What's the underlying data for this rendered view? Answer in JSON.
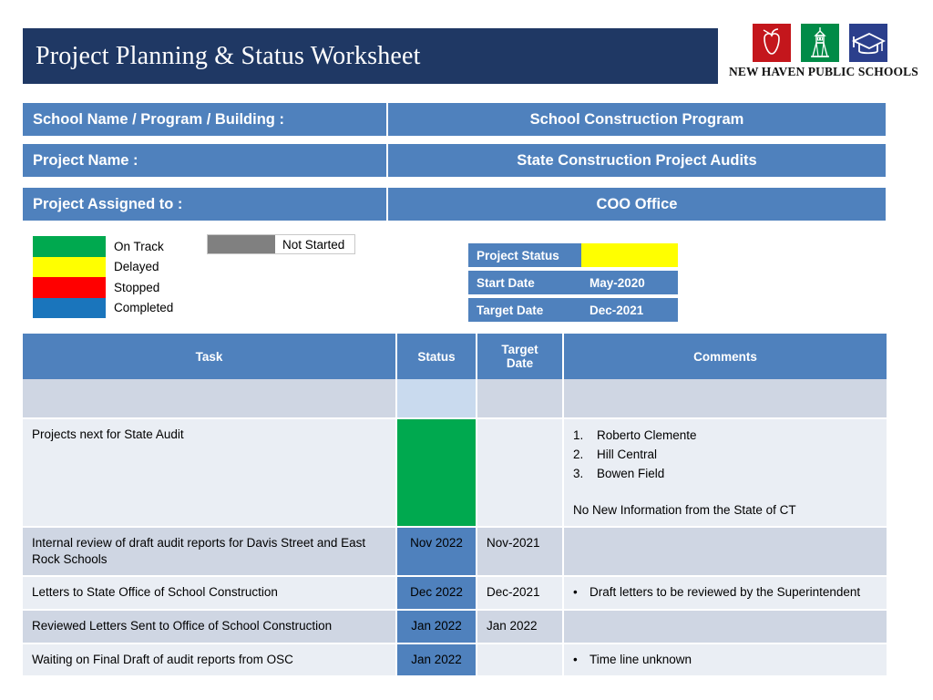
{
  "title": "Project Planning & Status Worksheet",
  "logo": {
    "wordmark": "NEW HAVEN PUBLIC SCHOOLS",
    "red_hex": "#C4161C",
    "green_hex": "#008B47",
    "blue_hex": "#2B3F8C"
  },
  "info": {
    "rows": [
      {
        "label": "School Name / Program / Building :",
        "value": "School Construction Program"
      },
      {
        "label": "Project Name :",
        "value": "State Construction Project Audits"
      },
      {
        "label": "Project Assigned to :",
        "value": "COO Office"
      }
    ]
  },
  "legend": {
    "items": [
      {
        "label": "On Track",
        "color": "#00A94F"
      },
      {
        "label": "Delayed",
        "color": "#FFFF00"
      },
      {
        "label": "Stopped",
        "color": "#FF0000"
      },
      {
        "label": "Completed",
        "color": "#1A75BC"
      }
    ],
    "not_started": {
      "label": "Not Started",
      "color": "#808080"
    }
  },
  "status_box": {
    "rows": [
      {
        "key": "Project Status",
        "value": "",
        "fill": "#FFFF00"
      },
      {
        "key": "Start Date",
        "value": "May-2020",
        "fill": "#4F81BD"
      },
      {
        "key": "Target  Date",
        "value": "Dec-2021",
        "fill": "#4F81BD"
      }
    ]
  },
  "table": {
    "headers": {
      "task": "Task",
      "status": "Status",
      "target_date_line1": "Target",
      "target_date_line2": "Date",
      "comments": "Comments"
    },
    "rows": [
      {
        "task": "",
        "status_text": "",
        "status_fill": "lightblue",
        "target_date": "",
        "comments": [],
        "band": "dark",
        "spacer": true
      },
      {
        "task": "Projects next for State Audit",
        "status_text": "",
        "status_fill": "green",
        "target_date": "",
        "numbered": [
          "Roberto Clemente",
          "Hill Central",
          "Bowen Field"
        ],
        "note": "No New Information from the State of CT",
        "band": "light"
      },
      {
        "task": "Internal review of draft audit reports for Davis Street and East Rock Schools",
        "status_text": "Nov 2022",
        "status_fill": "blue",
        "target_date": "Nov-2021",
        "comments": [],
        "band": "dark"
      },
      {
        "task": "Letters to State Office of School Construction",
        "status_text": "Dec 2022",
        "status_fill": "blue",
        "target_date": "Dec-2021",
        "comments": [
          "Draft letters to be reviewed by the Superintendent"
        ],
        "band": "light"
      },
      {
        "task": "Reviewed Letters Sent to Office of School Construction",
        "status_text": "Jan 2022",
        "status_fill": "blue",
        "target_date": "Jan 2022",
        "comments": [],
        "band": "dark"
      },
      {
        "task": "Waiting on Final Draft of audit reports from OSC",
        "status_text": "Jan 2022",
        "status_fill": "blue",
        "target_date": "",
        "comments": [
          "Time line unknown"
        ],
        "band": "light"
      }
    ]
  }
}
